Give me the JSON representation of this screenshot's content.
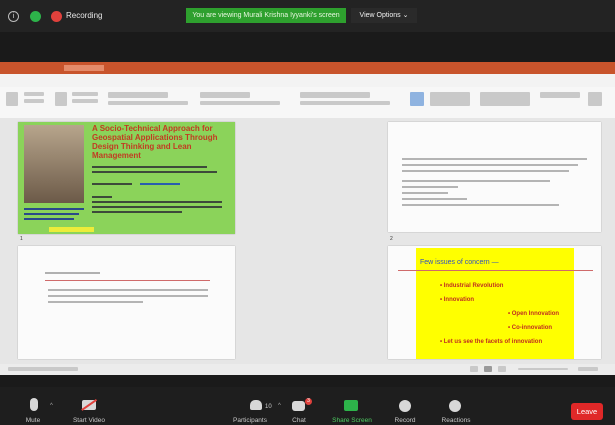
{
  "zoom_top": {
    "recording_label": "Recording",
    "share_banner": "You are viewing Murali Krishna Iyyanki's screen",
    "view_options": "View Options ⌄",
    "colors": {
      "banner": "#2ea02e",
      "recording": "#e0413c"
    }
  },
  "slides": {
    "slide1": {
      "number": "1",
      "title": "A Socio-Technical Approach for Geospatial Applications Through Design Thinking and Lean Management"
    },
    "slide2": {
      "number": "2"
    },
    "slide4": {
      "title": "Few issues of concern —",
      "items": [
        "• Industrial Revolution",
        "• Innovation",
        "• Open Innovation",
        "• Co-innovation",
        "• Let us see the facets of innovation"
      ]
    }
  },
  "zoom_bottom": {
    "mute": "Mute",
    "start_video": "Start Video",
    "participants": "Participants",
    "participant_count": "10",
    "chat": "Chat",
    "chat_badge": "3",
    "share_screen": "Share Screen",
    "record": "Record",
    "reactions": "Reactions",
    "leave": "Leave",
    "colors": {
      "share": "#2db34a",
      "leave": "#e02828"
    }
  }
}
